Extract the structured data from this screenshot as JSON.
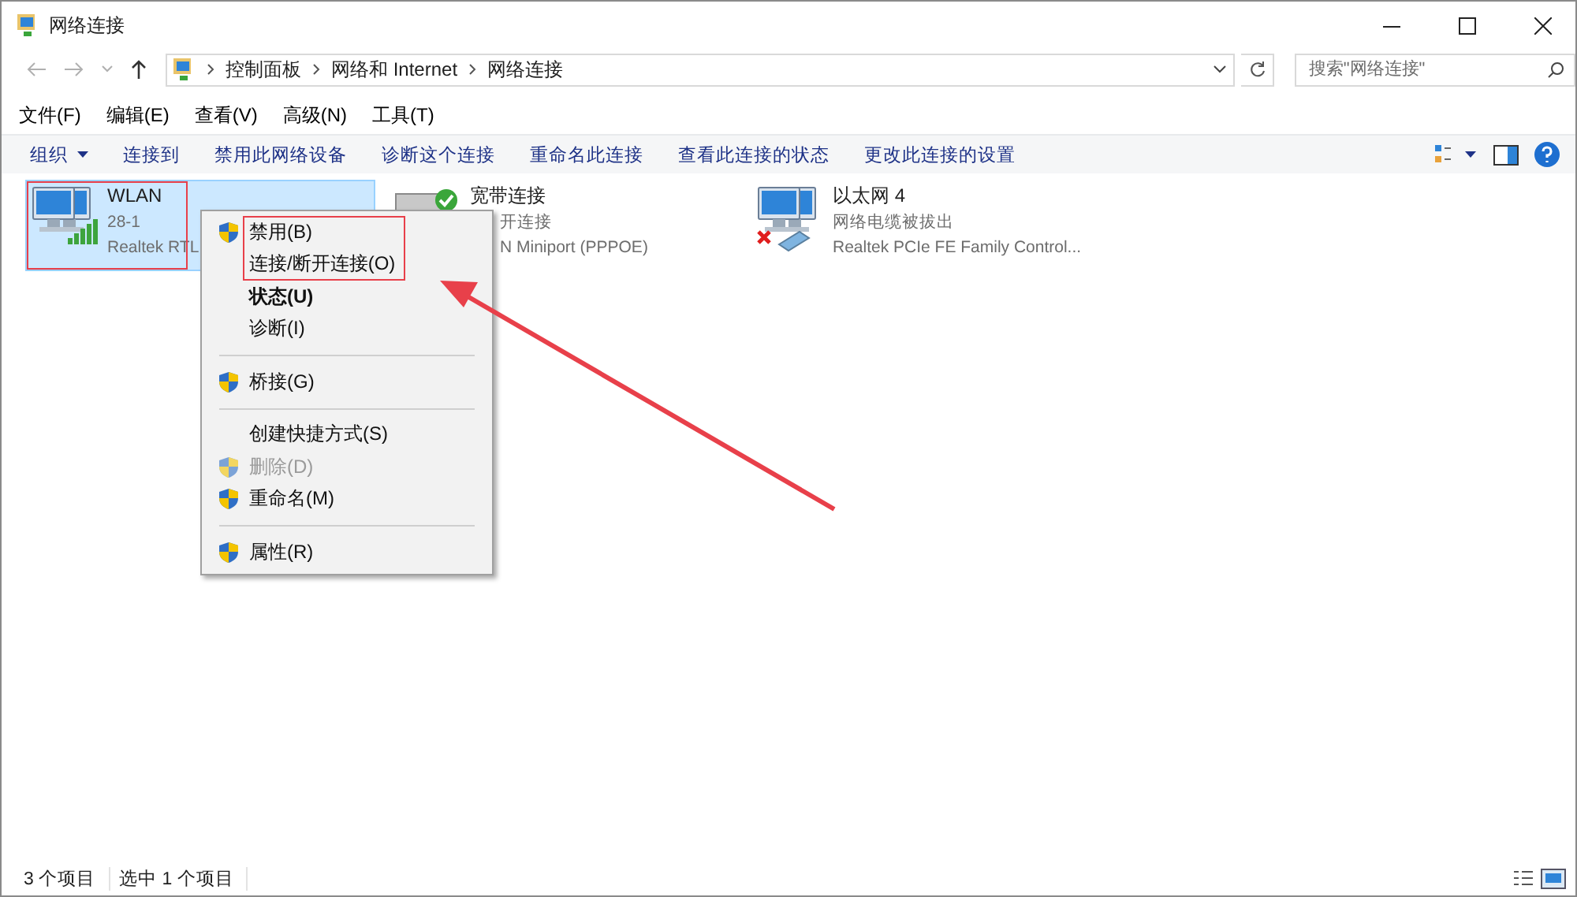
{
  "window": {
    "title": "网络连接"
  },
  "address": {
    "crumbs": [
      "控制面板",
      "网络和 Internet",
      "网络连接"
    ]
  },
  "search": {
    "placeholder": "搜索\"网络连接\""
  },
  "menubar": [
    "文件(F)",
    "编辑(E)",
    "查看(V)",
    "高级(N)",
    "工具(T)"
  ],
  "toolbar": [
    {
      "label": "组织",
      "dropdown": true
    },
    {
      "label": "连接到",
      "dropdown": false
    },
    {
      "label": "禁用此网络设备",
      "dropdown": false
    },
    {
      "label": "诊断这个连接",
      "dropdown": false
    },
    {
      "label": "重命名此连接",
      "dropdown": false
    },
    {
      "label": "查看此连接的状态",
      "dropdown": false
    },
    {
      "label": "更改此连接的设置",
      "dropdown": false
    }
  ],
  "connections": [
    {
      "kind": "wifi",
      "name": "WLAN",
      "status": "28-1",
      "device": "Realtek RTL",
      "selected": true,
      "covered": false
    },
    {
      "kind": "broadband",
      "name": "宽带连接",
      "status": "开连接",
      "device": "N Miniport (PPPOE)",
      "selected": false,
      "covered": true
    },
    {
      "kind": "ethernet",
      "name": "以太网 4",
      "status": "网络电缆被拔出",
      "device": "Realtek PCIe FE Family Control...",
      "selected": false,
      "covered": false
    }
  ],
  "context_menu": [
    {
      "kind": "item",
      "label": "禁用(B)",
      "shield": true,
      "bold": false,
      "disabled": false
    },
    {
      "kind": "item",
      "label": "连接/断开连接(O)",
      "shield": false,
      "bold": false,
      "disabled": false
    },
    {
      "kind": "item",
      "label": "状态(U)",
      "shield": false,
      "bold": true,
      "disabled": false
    },
    {
      "kind": "item",
      "label": "诊断(I)",
      "shield": false,
      "bold": false,
      "disabled": false
    },
    {
      "kind": "separator"
    },
    {
      "kind": "item",
      "label": "桥接(G)",
      "shield": true,
      "bold": false,
      "disabled": false
    },
    {
      "kind": "separator"
    },
    {
      "kind": "item",
      "label": "创建快捷方式(S)",
      "shield": false,
      "bold": false,
      "disabled": false
    },
    {
      "kind": "item",
      "label": "删除(D)",
      "shield": true,
      "bold": false,
      "disabled": true
    },
    {
      "kind": "item",
      "label": "重命名(M)",
      "shield": true,
      "bold": false,
      "disabled": false
    },
    {
      "kind": "separator"
    },
    {
      "kind": "item",
      "label": "属性(R)",
      "shield": true,
      "bold": false,
      "disabled": false
    }
  ],
  "status_bar": {
    "count": "3 个项目",
    "selection": "选中 1 个项目"
  }
}
